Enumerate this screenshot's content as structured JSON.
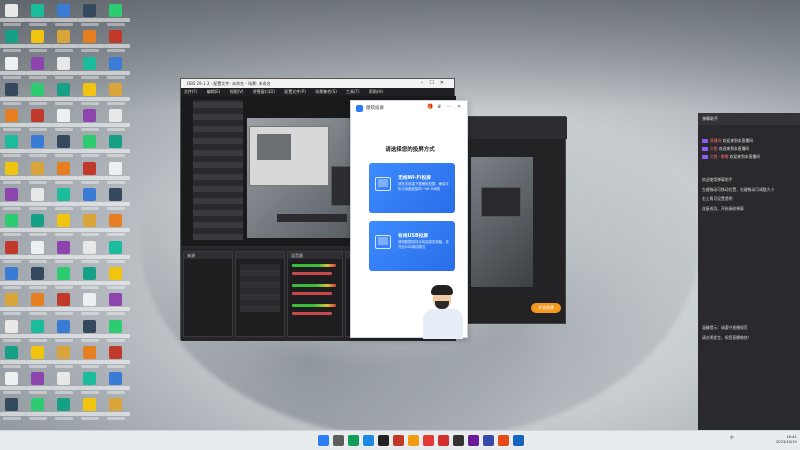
{
  "obs": {
    "title": "OBS 29.1.3 - 配置文件: 未命名 - 场景: 未命名",
    "menu": [
      "文件(F)",
      "编辑(E)",
      "视图(V)",
      "停靠窗口(D)",
      "配置文件(P)",
      "场景集合(S)",
      "工具(T)",
      "帮助(H)"
    ],
    "scenes_label": "来源",
    "sources_label": "混音器",
    "dock_bottom_label": "不是来源"
  },
  "dialog": {
    "app_name": "傲软投屏",
    "heading": "请选择您的投屏方式",
    "cards": [
      {
        "title": "无线Wi-Fi投屏",
        "desc": "请在手机端下载傲软投屏，确保手机与电脑连接同一Wi-Fi网络",
        "icon": "wifi-icon"
      },
      {
        "title": "有线USB投屏",
        "desc": "请用数据线将手机连接至电脑，并开启USB调试模式",
        "icon": "usb-icon"
      }
    ]
  },
  "right_window": {
    "start_label": "开始直播"
  },
  "side_panel": {
    "title": "弹幕助手",
    "rows": [
      {
        "name": "直播间",
        "text": "欢迎来到本直播间"
      },
      {
        "name": "大胜",
        "text": "欢迎来到本直播间"
      },
      {
        "name": "大胜~嘟嘟",
        "text": "欢迎来到本直播间"
      }
    ],
    "messages": [
      "欢迎使用弹幕助手",
      "左键拖动可移动位置，右键拖动可调整大小",
      "右上角可设置透明",
      "连接成功，开始接收弹幕",
      "温馨提示：请遵守直播规范",
      "请文明发言，祝您直播愉快！"
    ]
  },
  "taskbar": {
    "tray_text": "中",
    "time": "16:42",
    "date": "2023/10/19"
  }
}
